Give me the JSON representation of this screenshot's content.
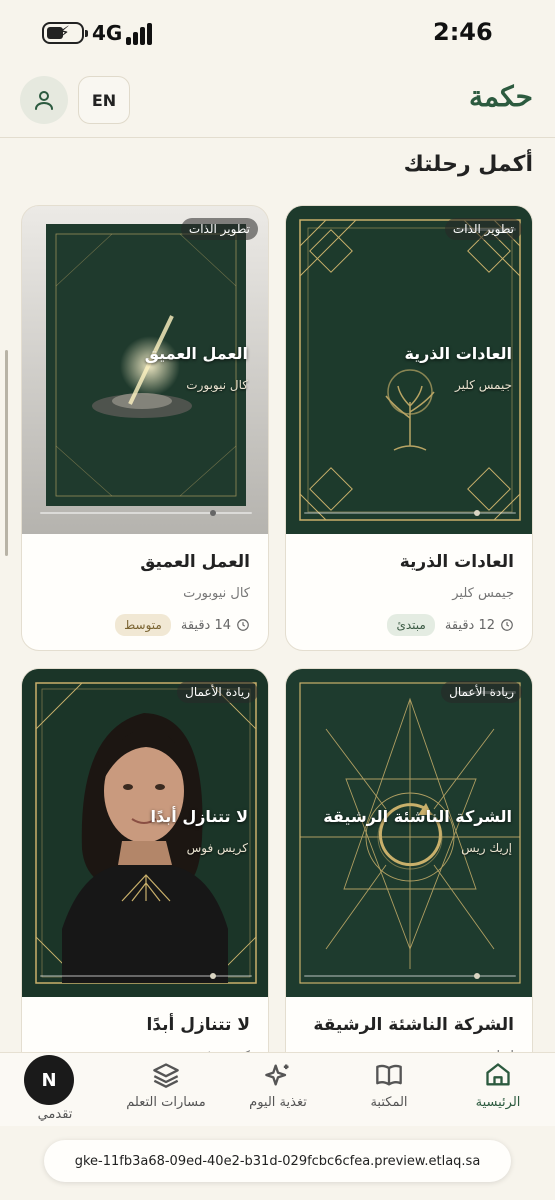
{
  "status_bar": {
    "network": "4G",
    "time": "2:46"
  },
  "header": {
    "brand": "حكمة",
    "lang_button": "EN"
  },
  "section": {
    "title": "أكمل رحلتك"
  },
  "cards": [
    {
      "tag": "تطوير الذات",
      "title": "العادات الذرية",
      "author": "جيمس كلير",
      "duration": "12 دقيقة",
      "level": "مبتدئ"
    },
    {
      "tag": "تطوير الذات",
      "title": "العمل العميق",
      "author": "كال نيوبورت",
      "duration": "14 دقيقة",
      "level": "متوسط"
    },
    {
      "tag": "ريادة الأعمال",
      "title": "الشركة الناشئة الرشيقة",
      "author": "إريك ريس"
    },
    {
      "tag": "ريادة الأعمال",
      "title": "لا تتنازل أبدًا",
      "author": "كريس فوس"
    }
  ],
  "nav": {
    "home": "الرئيسية",
    "library": "المكتبة",
    "feed": "تغذية اليوم",
    "paths": "مسارات التعلم",
    "progress": "تقدمي",
    "avatar_letter": "N"
  },
  "url": "gke-11fb3a68-09ed-40e2-b31d-029fcbc6cfea.preview.etlaq.sa",
  "colors": {
    "brand_green": "#2c5a3f",
    "cover_green": "#1c3b2d",
    "gold": "#c9b06b",
    "background": "#f7f4ec"
  }
}
